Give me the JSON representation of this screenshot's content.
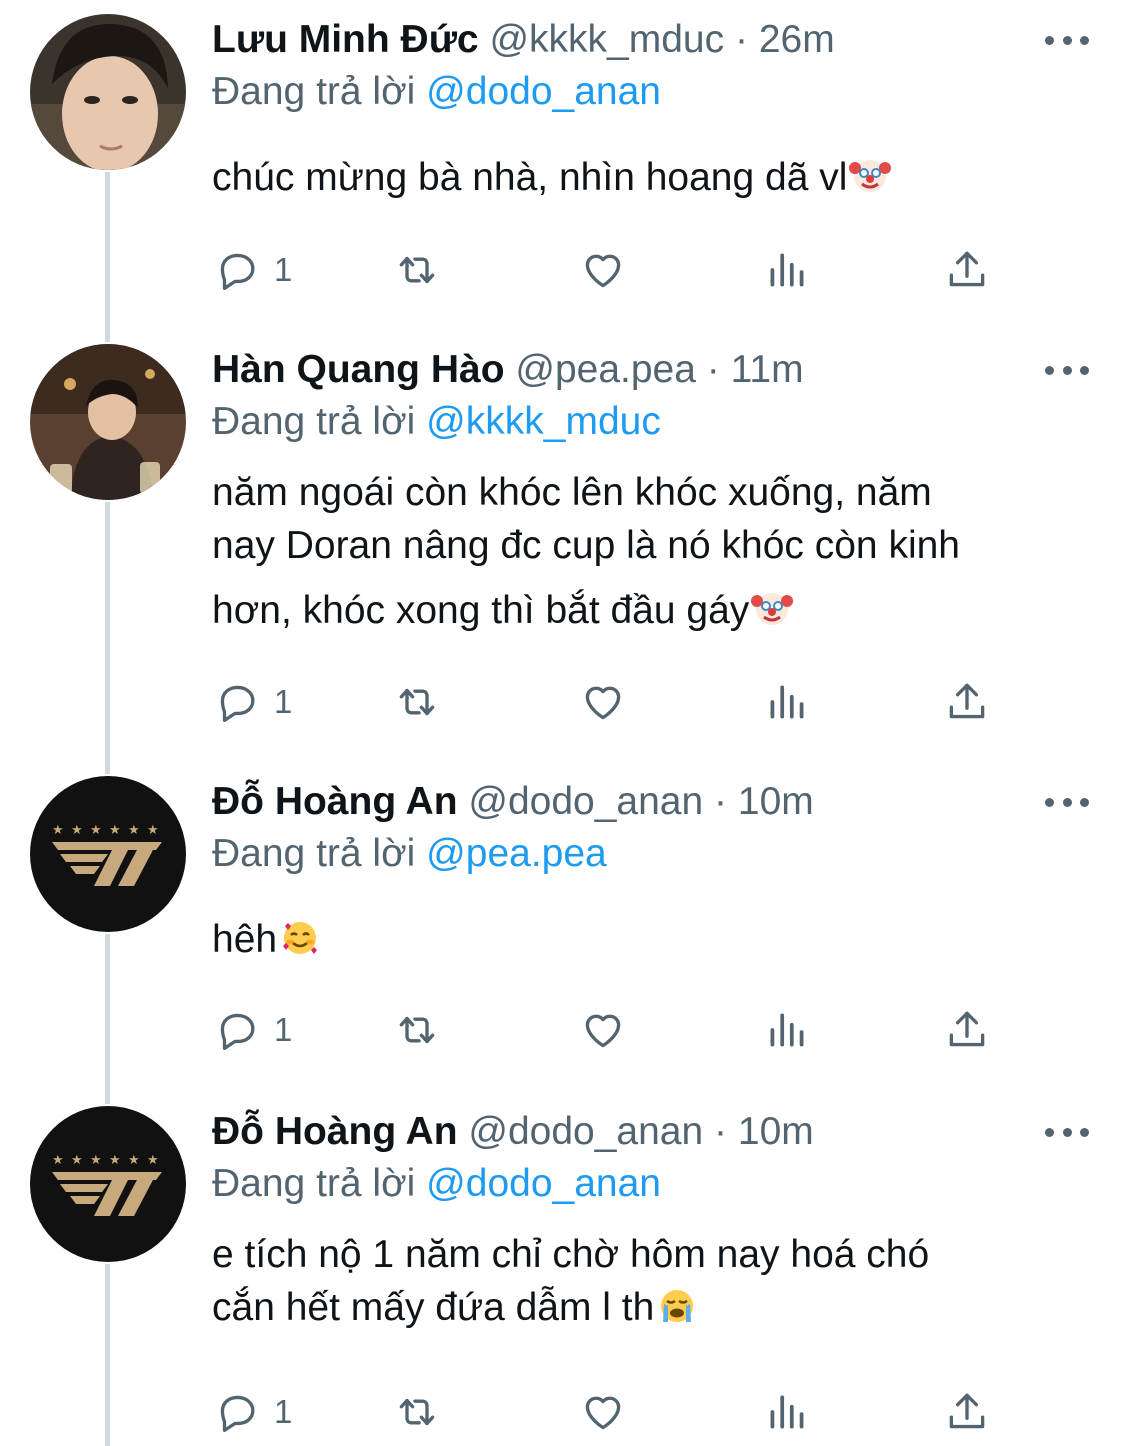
{
  "tweets": [
    {
      "name": "Lưu Minh Đức",
      "handle": "@kkkk_mduc",
      "dot": "·",
      "time": "26m",
      "replying_prefix": "Đang trả lời",
      "replying_to": "@dodo_anan",
      "text": "chúc mừng bà nhà, nhìn hoang dã vl",
      "emoji": "clown-face",
      "reply_count": "1"
    },
    {
      "name": "Hàn Quang Hào",
      "handle": "@pea.pea",
      "dot": "·",
      "time": "11m",
      "replying_prefix": "Đang trả lời",
      "replying_to": "@kkkk_mduc",
      "text_lines": [
        "năm ngoái còn khóc lên khóc xuống, năm",
        "nay Doran nâng đc cup là nó khóc còn kinh",
        "hơn, khóc xong thì bắt đầu gáy"
      ],
      "emoji": "clown-face",
      "reply_count": "1"
    },
    {
      "name": "Đỗ Hoàng An",
      "handle": "@dodo_anan",
      "dot": "·",
      "time": "10m",
      "replying_prefix": "Đang trả lời",
      "replying_to": "@pea.pea",
      "text": "hêh",
      "emoji": "smiling-face-with-hearts",
      "reply_count": "1"
    },
    {
      "name": "Đỗ Hoàng An",
      "handle": "@dodo_anan",
      "dot": "·",
      "time": "10m",
      "replying_prefix": "Đang trả lời",
      "replying_to": "@dodo_anan",
      "text_lines": [
        "e tích nộ 1 năm chỉ chờ hôm nay hoá chó",
        "cắn hết mấy đứa dẫm l th"
      ],
      "emoji": "loudly-crying-face",
      "reply_count": "1"
    }
  ],
  "colors": {
    "text": "#0f1419",
    "secondary": "#536471",
    "link": "#1d9bf0",
    "thread_line": "#cfd9de",
    "t1_logo_bg": "#111111",
    "t1_logo_gold": "#c8a97e"
  },
  "icons": [
    "reply-icon",
    "retweet-icon",
    "like-icon",
    "views-icon",
    "share-icon",
    "more-icon"
  ]
}
